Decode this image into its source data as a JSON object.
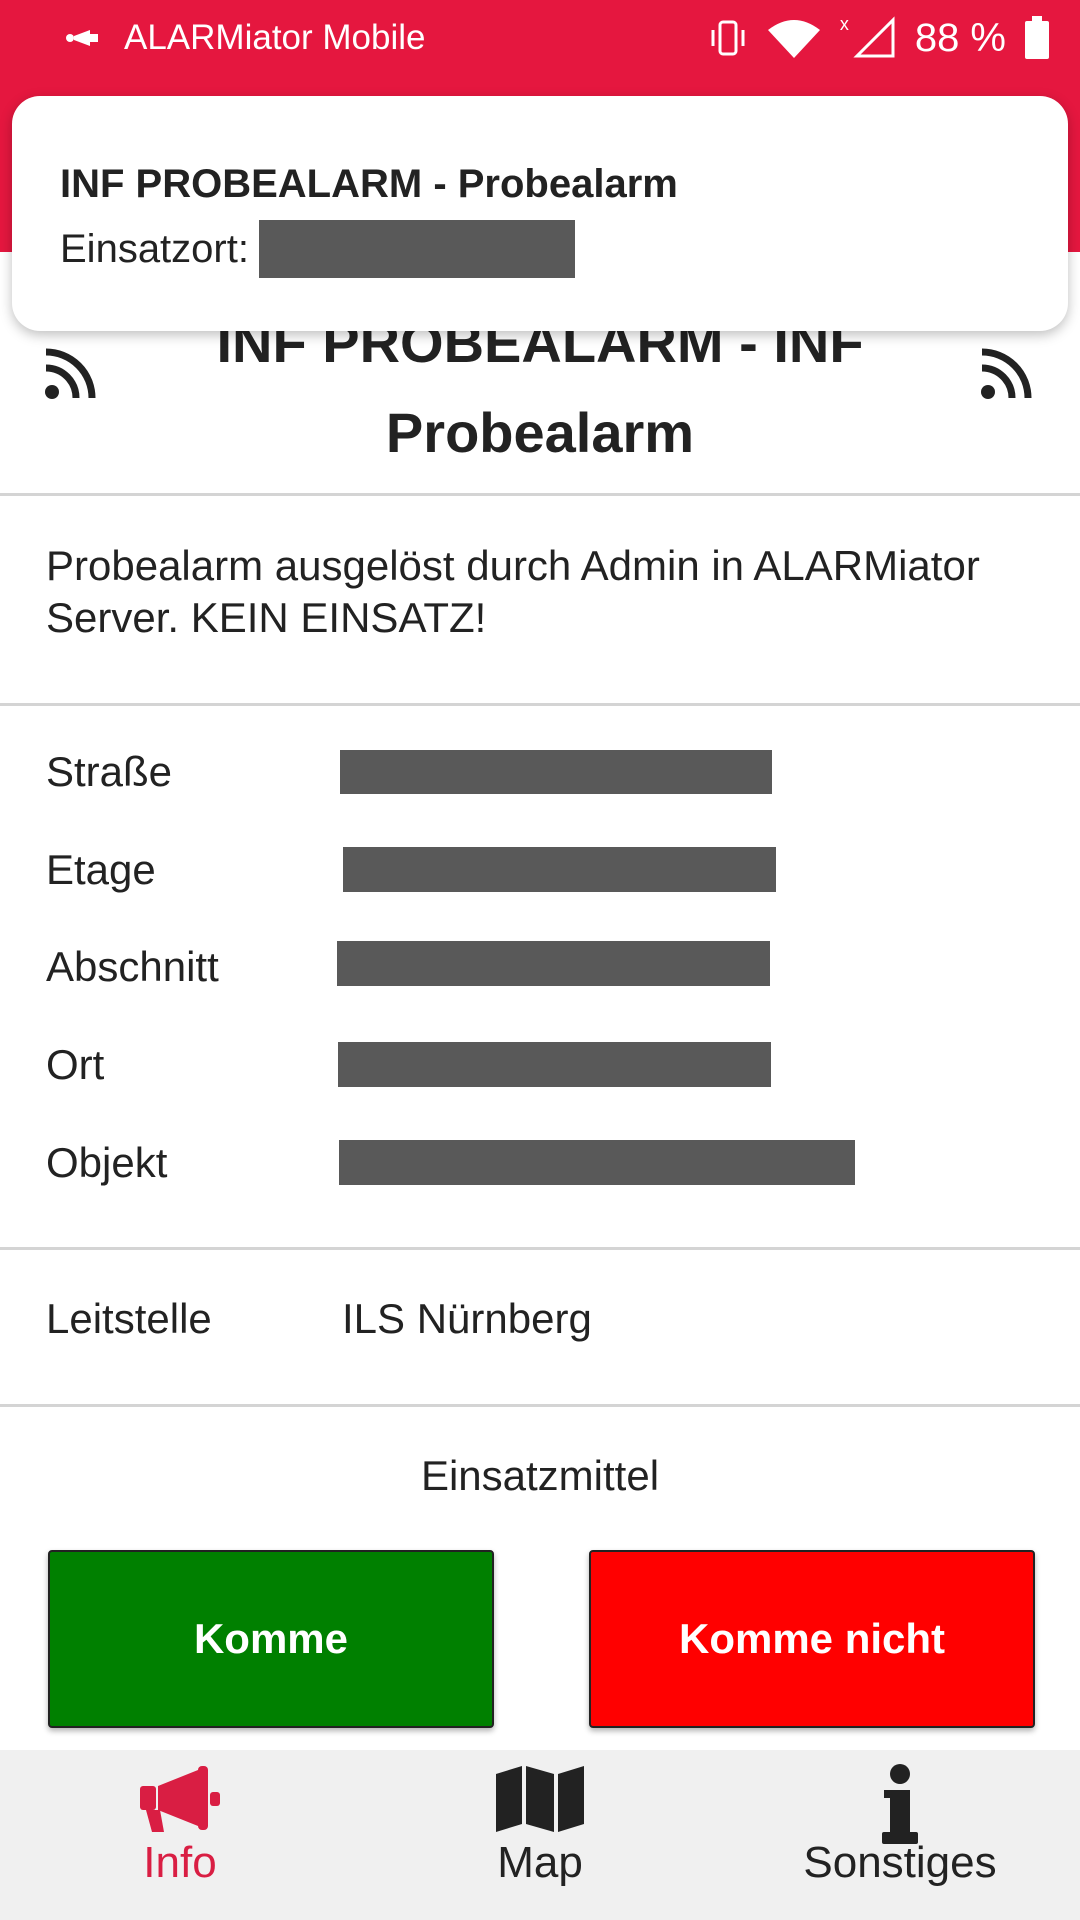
{
  "status_bar": {
    "app_name": "ALARMiator Mobile",
    "battery": "88 %",
    "signal_badge": "x",
    "icons": [
      "horn-icon",
      "vibrate-icon",
      "wifi-icon",
      "signal-icon",
      "battery-icon"
    ]
  },
  "notification": {
    "title": "INF PROBEALARM - Probealarm",
    "location_label": "Einsatzort:"
  },
  "alarm": {
    "title": "INF PROBEALARM - INF Probealarm",
    "description": "Probealarm ausgelöst durch Admin in ALARMiator Server. KEIN EINSATZ!"
  },
  "details": [
    {
      "label": "Straße"
    },
    {
      "label": "Etage"
    },
    {
      "label": "Abschnitt"
    },
    {
      "label": "Ort"
    },
    {
      "label": "Objekt"
    }
  ],
  "dispatch": {
    "label": "Leitstelle",
    "value": "ILS Nürnberg"
  },
  "resources": {
    "title": "Einsatzmittel"
  },
  "actions": {
    "accept_label": "Komme",
    "decline_label": "Komme nicht",
    "accept_color": "#008000",
    "decline_color": "#ff0000"
  },
  "nav": {
    "items": [
      {
        "label": "Info",
        "icon": "megaphone-icon"
      },
      {
        "label": "Map",
        "icon": "map-icon"
      },
      {
        "label": "Sonstiges",
        "icon": "info-icon"
      }
    ],
    "active_color": "#d91e43"
  },
  "theme": {
    "brand": "#e5173f"
  }
}
